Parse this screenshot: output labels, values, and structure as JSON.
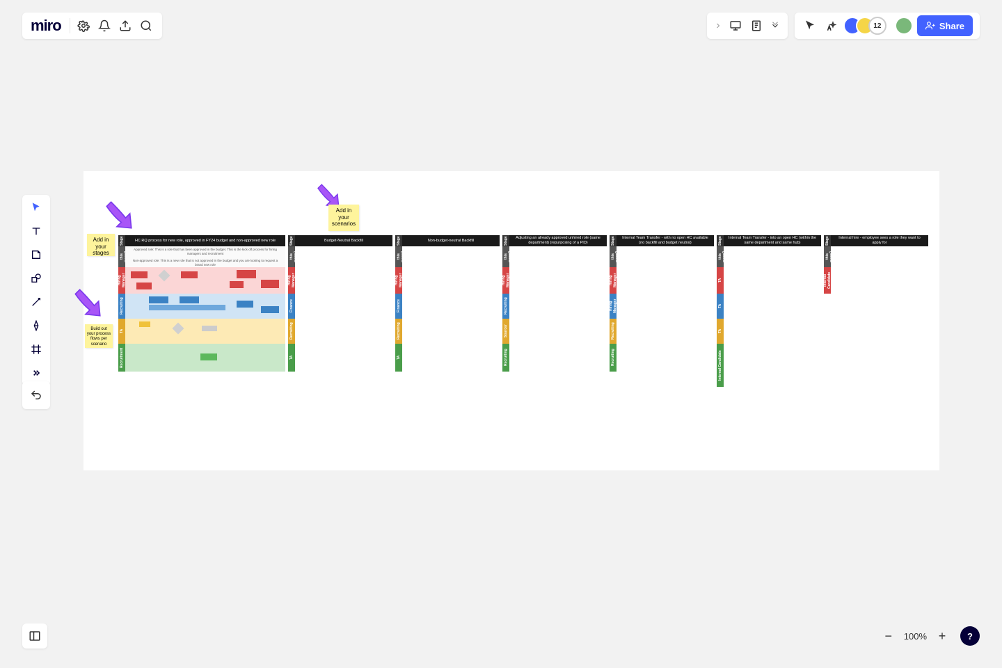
{
  "app": {
    "logo": "miro"
  },
  "collab": {
    "count_badge": "12",
    "share_label": "Share"
  },
  "zoom": {
    "level": "100%"
  },
  "stickies": {
    "stages": "Add in your stages",
    "scenarios": "Add in your scenarios",
    "build": "Build out your process flows per scenario"
  },
  "swimlanes": {
    "vlabel_stage": "Stage",
    "vlabel_what": "What does this mean?",
    "headers": [
      "HC RQ process for new role, approved in FY24 budget and non-approved new role",
      "Budget-Neutral Backfill",
      "Non-budget-neutral Backfill",
      "Adjusting an already approved unhired role (same department) (repurposing of a PID)",
      "Internal Team Transfer - with no open HC available (no backfill and budget neutral)",
      "Internal Team Transfer - into an open HC (within the same department and same hub)",
      "Internal hire - employee sees a role they want to apply for"
    ],
    "desc_line1": "Approved role: This is a role that has been approved in the budget. This is the kick-off process for hiring managers and recruitment",
    "desc_line2": "Non-approved role: This is a new role that is not approved in the budget and you are looking to request a brand new role",
    "rows": {
      "r1": "Hiring Manager",
      "r2": "Recruiting",
      "r3": "TA",
      "r4": "Recruitment",
      "alt1": "Finance",
      "alt2": "Sourcer",
      "alt_ext": "Internal Candidate"
    }
  }
}
